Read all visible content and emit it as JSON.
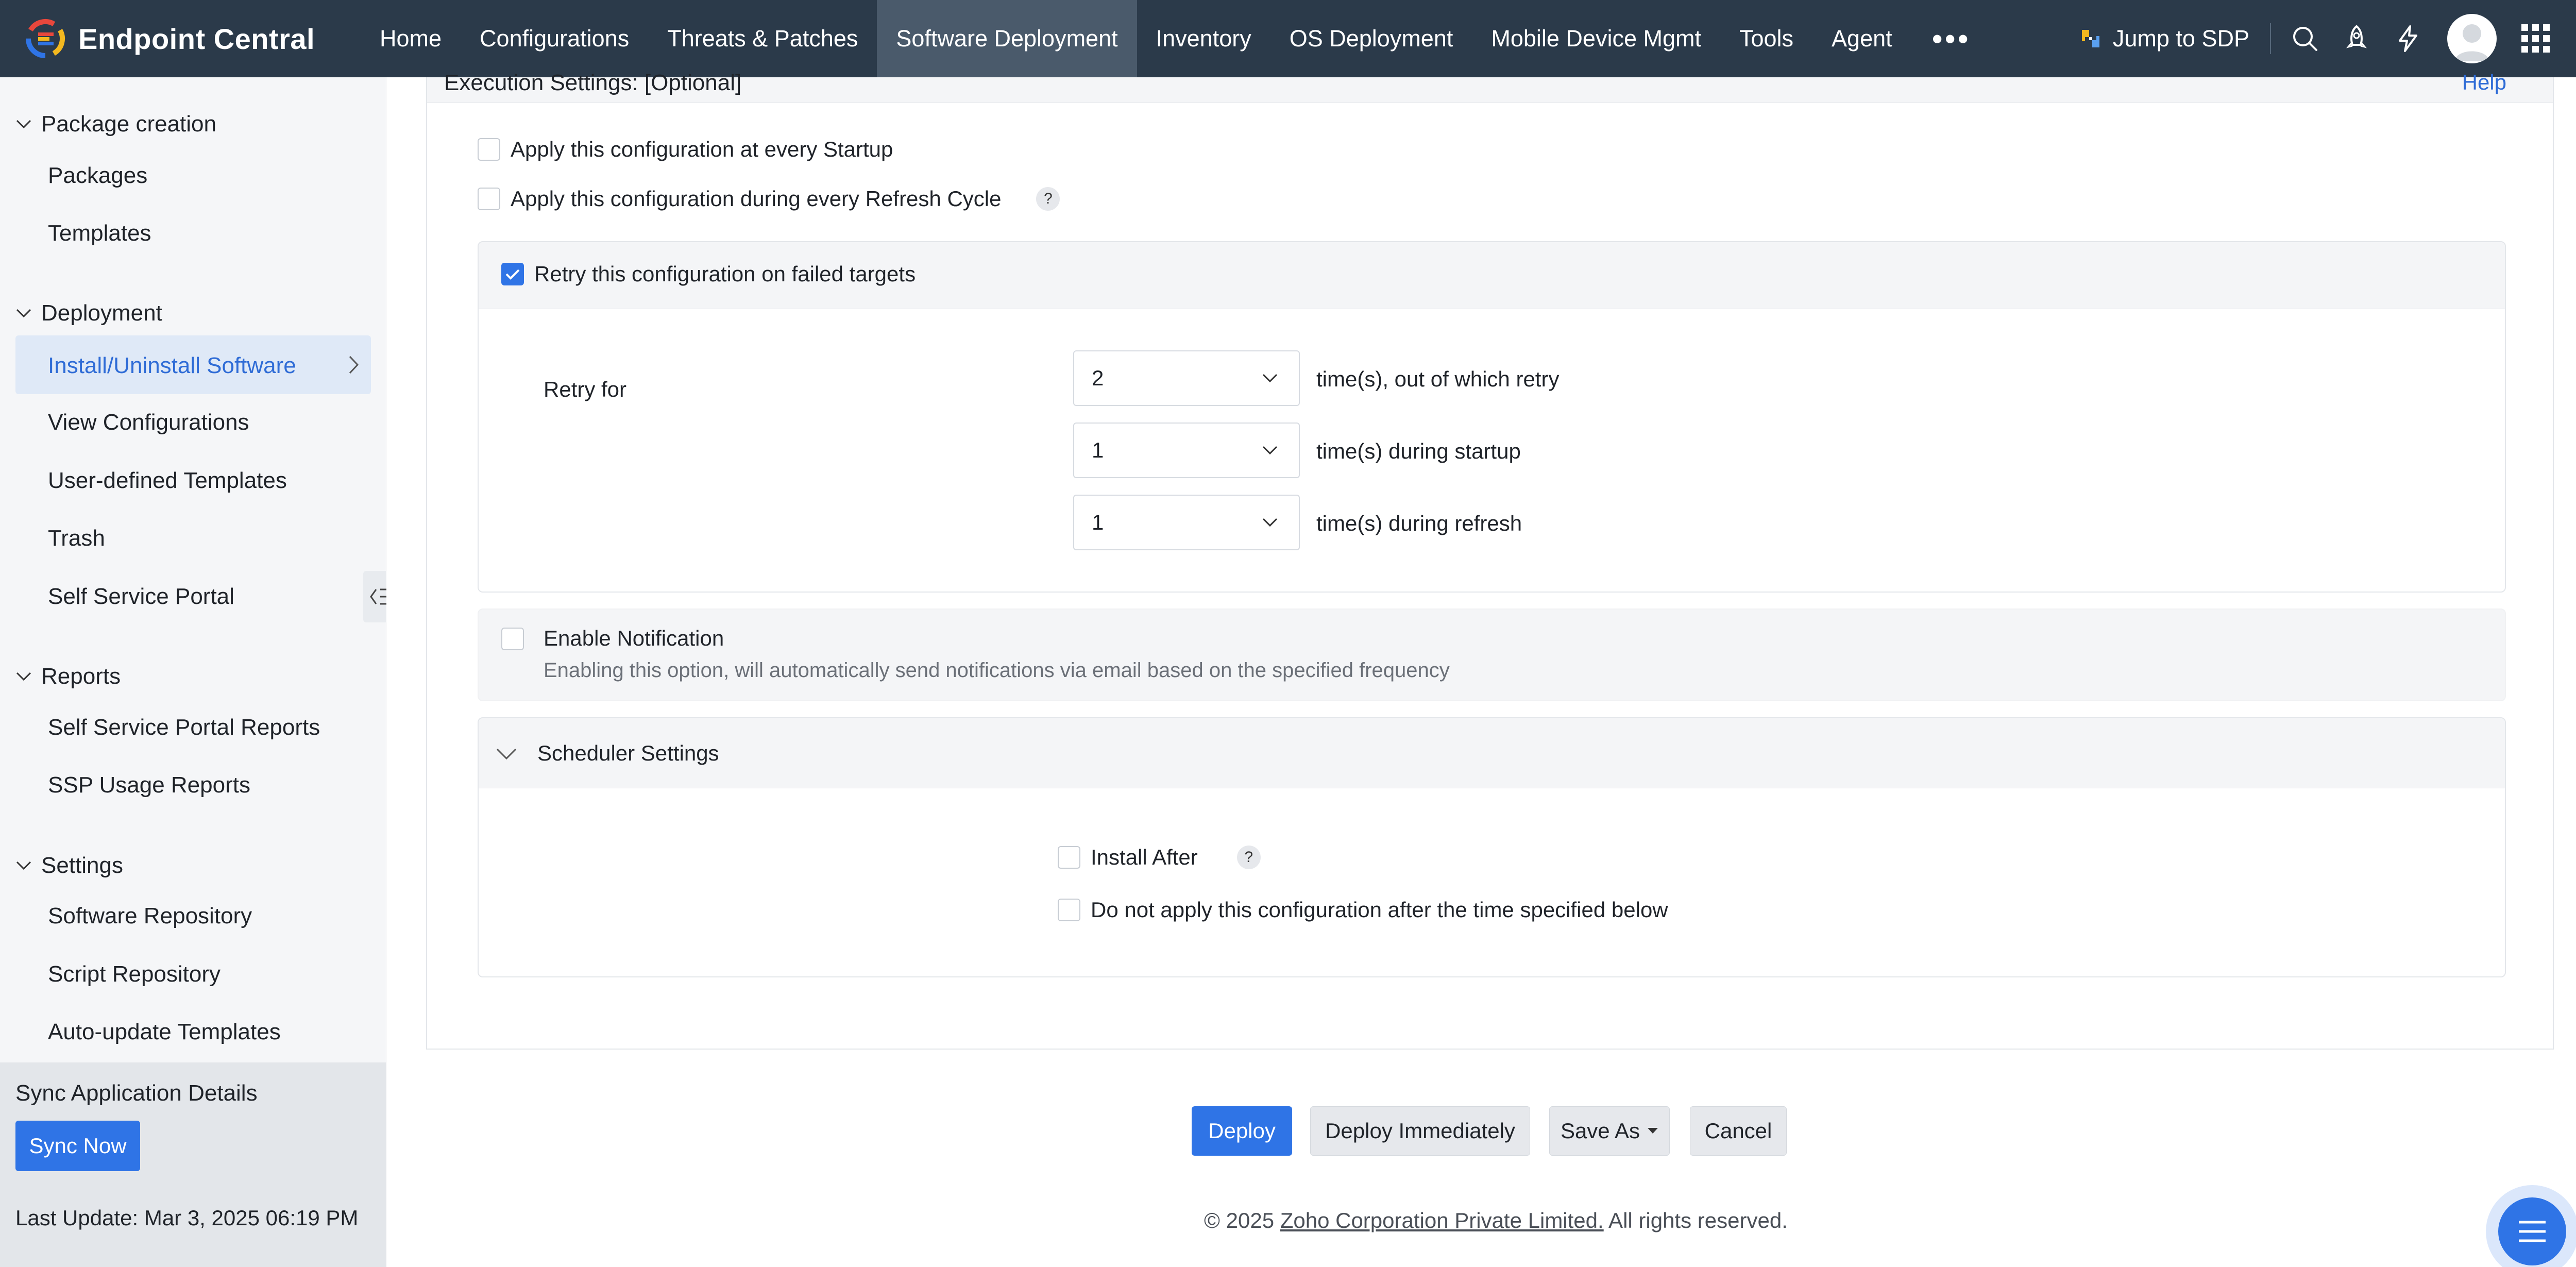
{
  "app": {
    "name": "Endpoint Central"
  },
  "nav": {
    "items": [
      "Home",
      "Configurations",
      "Threats & Patches",
      "Software Deployment",
      "Inventory",
      "OS Deployment",
      "Mobile Device Mgmt",
      "Tools",
      "Agent"
    ],
    "active": "Software Deployment",
    "more": "•••",
    "jump_sdp": "Jump to SDP"
  },
  "sidebar": {
    "sections": [
      {
        "label": "Package creation",
        "items": [
          "Packages",
          "Templates"
        ]
      },
      {
        "label": "Deployment",
        "items": [
          "Install/Uninstall Software",
          "View Configurations",
          "User-defined Templates",
          "Trash",
          "Self Service Portal"
        ]
      },
      {
        "label": "Reports",
        "items": [
          "Self Service Portal Reports",
          "SSP Usage Reports"
        ]
      },
      {
        "label": "Settings",
        "items": [
          "Software Repository",
          "Script Repository",
          "Auto-update Templates"
        ]
      }
    ],
    "active_item": "Install/Uninstall Software",
    "sync": {
      "title": "Sync Application Details",
      "button": "Sync Now",
      "last_update": "Last Update: Mar 3, 2025 06:19 PM"
    }
  },
  "execution": {
    "title": "Execution Settings: [Optional]",
    "help": "Help",
    "apply_startup": {
      "label": "Apply this configuration at every Startup",
      "checked": false
    },
    "apply_refresh": {
      "label": "Apply this configuration during every Refresh Cycle",
      "checked": false,
      "help": "?"
    },
    "retry": {
      "label": "Retry this configuration on failed targets",
      "checked": true,
      "retry_for_label": "Retry for",
      "times": {
        "value": "2",
        "suffix": "time(s), out of which retry"
      },
      "startup": {
        "value": "1",
        "suffix": "time(s) during startup"
      },
      "refresh": {
        "value": "1",
        "suffix": "time(s) during refresh"
      }
    },
    "notification": {
      "label": "Enable Notification",
      "checked": false,
      "description": "Enabling this option, will automatically send notifications via email based on the specified frequency"
    },
    "scheduler": {
      "label": "Scheduler Settings",
      "install_after": {
        "label": "Install After",
        "checked": false,
        "help": "?"
      },
      "do_not_apply": {
        "label": "Do not apply this configuration after the time specified below",
        "checked": false
      }
    }
  },
  "actions": {
    "deploy": "Deploy",
    "deploy_immediately": "Deploy Immediately",
    "save_as": "Save As",
    "cancel": "Cancel"
  },
  "footer": {
    "prefix": "© 2025 ",
    "company": "Zoho Corporation Private Limited.",
    "suffix": " All rights reserved."
  },
  "colors": {
    "topbar": "#2b3a4a",
    "accent": "#2f74e6",
    "link": "#2f6cd6"
  }
}
